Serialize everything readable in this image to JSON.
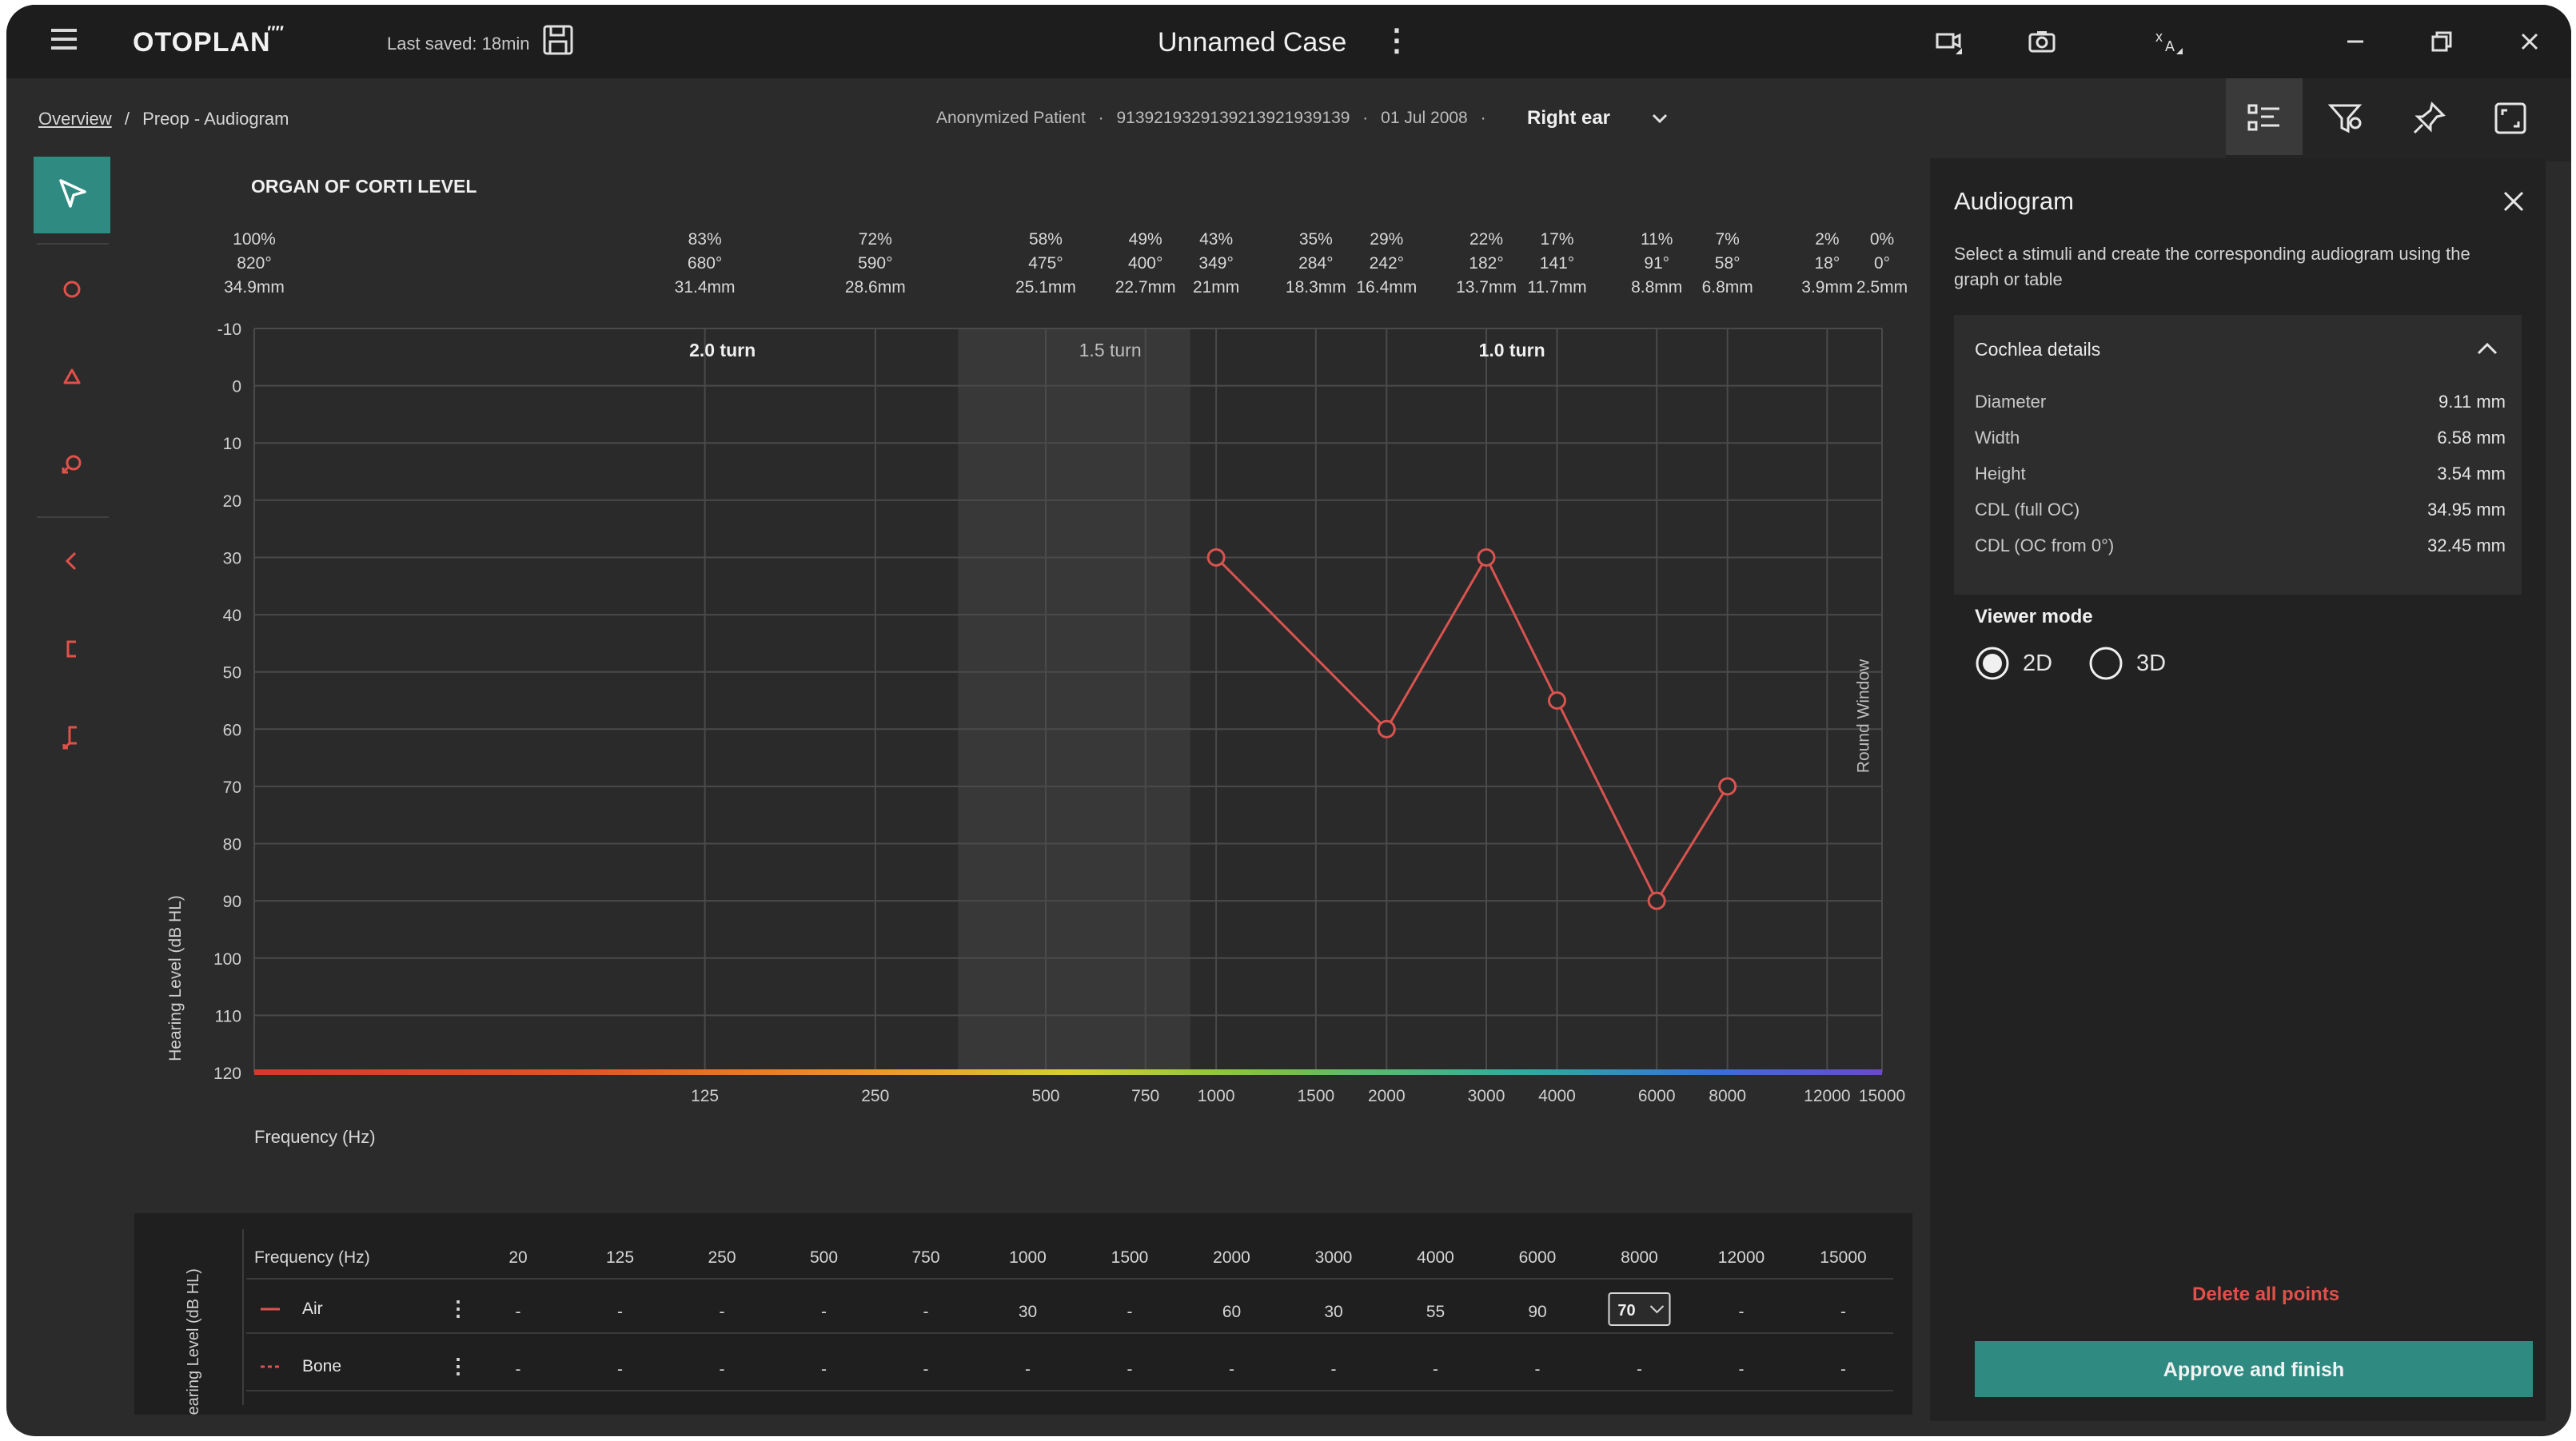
{
  "app": {
    "logo": "OTOPLAN",
    "last_saved": "Last saved: 18min",
    "case_title": "Unnamed Case"
  },
  "breadcrumb": {
    "overview": "Overview",
    "separator": "/",
    "current": "Preop - Audiogram"
  },
  "patient": {
    "name": "Anonymized Patient",
    "id": "9139219329139213921939139",
    "date": "01 Jul 2008",
    "ear": "Right ear"
  },
  "chart": {
    "title": "ORGAN OF CORTI LEVEL",
    "turns": [
      "2.0 turn",
      "1.5 turn",
      "1.0 turn"
    ],
    "round_window": "Round Window",
    "ylabel": "Hearing Level (dB HL)",
    "xlabel": "Frequency (Hz)"
  },
  "chart_data": {
    "type": "line",
    "x_scale": "log",
    "y_inverted": true,
    "ylim": [
      -10,
      120
    ],
    "xlim": [
      20,
      15000
    ],
    "y_ticks": [
      -10,
      0,
      10,
      20,
      30,
      40,
      50,
      60,
      70,
      80,
      90,
      100,
      110,
      120
    ],
    "x_ticks": [
      125,
      250,
      500,
      750,
      1000,
      1500,
      2000,
      3000,
      4000,
      6000,
      8000,
      12000,
      15000
    ],
    "top_scale": [
      {
        "freq": 125,
        "percent": "83%",
        "angle": "680°",
        "length": "31.4mm"
      },
      {
        "freq": 250,
        "percent": "72%",
        "angle": "590°",
        "length": "28.6mm"
      },
      {
        "freq": 500,
        "percent": "58%",
        "angle": "475°",
        "length": "25.1mm"
      },
      {
        "freq": 750,
        "percent": "49%",
        "angle": "400°",
        "length": "22.7mm"
      },
      {
        "freq": 1000,
        "percent": "43%",
        "angle": "349°",
        "length": "21mm"
      },
      {
        "freq": 1500,
        "percent": "35%",
        "angle": "284°",
        "length": "18.3mm"
      },
      {
        "freq": 2000,
        "percent": "29%",
        "angle": "242°",
        "length": "16.4mm"
      },
      {
        "freq": 3000,
        "percent": "22%",
        "angle": "182°",
        "length": "13.7mm"
      },
      {
        "freq": 4000,
        "percent": "17%",
        "angle": "141°",
        "length": "11.7mm"
      },
      {
        "freq": 6000,
        "percent": "11%",
        "angle": "91°",
        "length": "8.8mm"
      },
      {
        "freq": 8000,
        "percent": "7%",
        "angle": "58°",
        "length": "6.8mm"
      },
      {
        "freq": 12000,
        "percent": "2%",
        "angle": "18°",
        "length": "3.9mm"
      },
      {
        "freq": 15000,
        "percent": "0%",
        "angle": "0°",
        "length": "2.5mm"
      }
    ],
    "top_scale_first": {
      "percent": "100%",
      "angle": "820°",
      "length": "34.9mm"
    },
    "shaded_region": [
      350,
      900
    ],
    "round_window_freq": 12000,
    "series": [
      {
        "name": "Air",
        "color": "#d9534f",
        "x": [
          1000,
          2000,
          3000,
          4000,
          6000,
          8000
        ],
        "y": [
          30,
          60,
          30,
          55,
          90,
          70
        ]
      }
    ]
  },
  "table": {
    "side_label": "Hearing Level (dB HL)",
    "header_label": "Frequency (Hz)",
    "frequencies": [
      "20",
      "125",
      "250",
      "500",
      "750",
      "1000",
      "1500",
      "2000",
      "3000",
      "4000",
      "6000",
      "8000",
      "12000",
      "15000"
    ],
    "rows": [
      {
        "label": "Air",
        "values": [
          "-",
          "-",
          "-",
          "-",
          "-",
          "30",
          "-",
          "60",
          "30",
          "55",
          "90",
          "70",
          "-",
          "-"
        ],
        "selected_index": 11
      },
      {
        "label": "Bone",
        "values": [
          "-",
          "-",
          "-",
          "-",
          "-",
          "-",
          "-",
          "-",
          "-",
          "-",
          "-",
          "-",
          "-",
          "-"
        ],
        "selected_index": -1
      }
    ]
  },
  "side_panel": {
    "title": "Audiogram",
    "description": "Select a stimuli and create the corresponding audiogram using the graph or table",
    "cochlea_title": "Cochlea details",
    "details": [
      {
        "label": "Diameter",
        "value": "9.11 mm"
      },
      {
        "label": "Width",
        "value": "6.58 mm"
      },
      {
        "label": "Height",
        "value": "3.54 mm"
      },
      {
        "label": "CDL (full OC)",
        "value": "34.95 mm"
      },
      {
        "label": "CDL (OC from 0°)",
        "value": "32.45 mm"
      }
    ],
    "viewer_mode_label": "Viewer mode",
    "viewer_modes": [
      "2D",
      "3D"
    ],
    "viewer_selected": "2D",
    "delete_all": "Delete all points",
    "approve": "Approve and finish"
  },
  "colors": {
    "accent": "#2f8b82",
    "series_air": "#d9534f",
    "danger": "#e2504a",
    "background": "#2b2b2b"
  }
}
